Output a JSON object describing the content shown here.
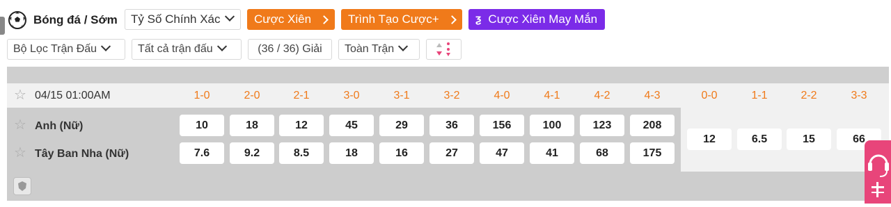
{
  "header": {
    "sport_title": "Bóng đá / Sớm",
    "market_select": "Tỷ Số Chính Xác",
    "parlay_button": "Cược Xiên",
    "bet_builder_button": "Trình Tạo Cược+",
    "lucky_parlay_button": "Cược Xiên May Mắn"
  },
  "filters": {
    "match_filter": "Bộ Lọc Trận Đấu",
    "all_matches": "Tất cả trận đấu",
    "leagues": "(36 / 36) Giải",
    "period": "Toàn Trận"
  },
  "match": {
    "datetime": "04/15 01:00AM",
    "home_team": "Anh (Nữ)",
    "away_team": "Tây Ban Nha (Nữ)",
    "win_scores": [
      "1-0",
      "2-0",
      "2-1",
      "3-0",
      "3-1",
      "3-2",
      "4-0",
      "4-1",
      "4-2",
      "4-3"
    ],
    "draw_scores": [
      "0-0",
      "1-1",
      "2-2",
      "3-3"
    ],
    "home_odds": [
      "10",
      "18",
      "12",
      "45",
      "29",
      "36",
      "156",
      "100",
      "123",
      "208"
    ],
    "away_odds": [
      "7.6",
      "9.2",
      "8.5",
      "18",
      "16",
      "27",
      "47",
      "41",
      "68",
      "175"
    ],
    "draw_odds": [
      "12",
      "6.5",
      "15",
      "66"
    ]
  },
  "colors": {
    "accent_orange": "#f07a1a",
    "purple": "#7b2be8",
    "support_pink": "#e8457a"
  }
}
